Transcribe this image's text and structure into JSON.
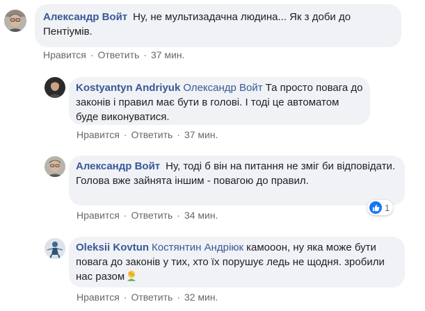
{
  "comments": [
    {
      "author": "Александр Войт",
      "mention": "",
      "text": "Ну, не мультизадачна людина... Як з доби до Пентіумів.",
      "like": "Нравится",
      "reply": "Ответить",
      "time": "37 мин."
    },
    {
      "author": "Kostyantyn Andriyuk",
      "mention": "Олександр Войт",
      "text": "Та просто повага до законів і правил має бути в голові. І тоді це автоматом буде виконуватися.",
      "like": "Нравится",
      "reply": "Ответить",
      "time": "37 мин."
    },
    {
      "author": "Александр Войт",
      "mention": "",
      "text": "Ну, тоді б він на питання не зміг би відповідати. Голова вже зайнята іншим - повагою до правил.",
      "like": "Нравится",
      "reply": "Ответить",
      "time": "34 мин.",
      "reaction_count": "1"
    },
    {
      "author": "Oleksii Kovtun",
      "mention": "Костянтин Андріюк",
      "text": "камооон, ну яка може бути повага до законів у тих, хто їх порушує ледь не щодня. зробили нас разом",
      "like": "Нравится",
      "reply": "Ответить",
      "time": "32 мин."
    }
  ],
  "separator": "·",
  "colors": {
    "link": "#385898",
    "bubble": "#f0f2f5",
    "meta": "#65676b",
    "like": "#1877f2"
  },
  "icons": {
    "reaction": "like-icon",
    "emoji": "facepalm-emoji-icon"
  }
}
